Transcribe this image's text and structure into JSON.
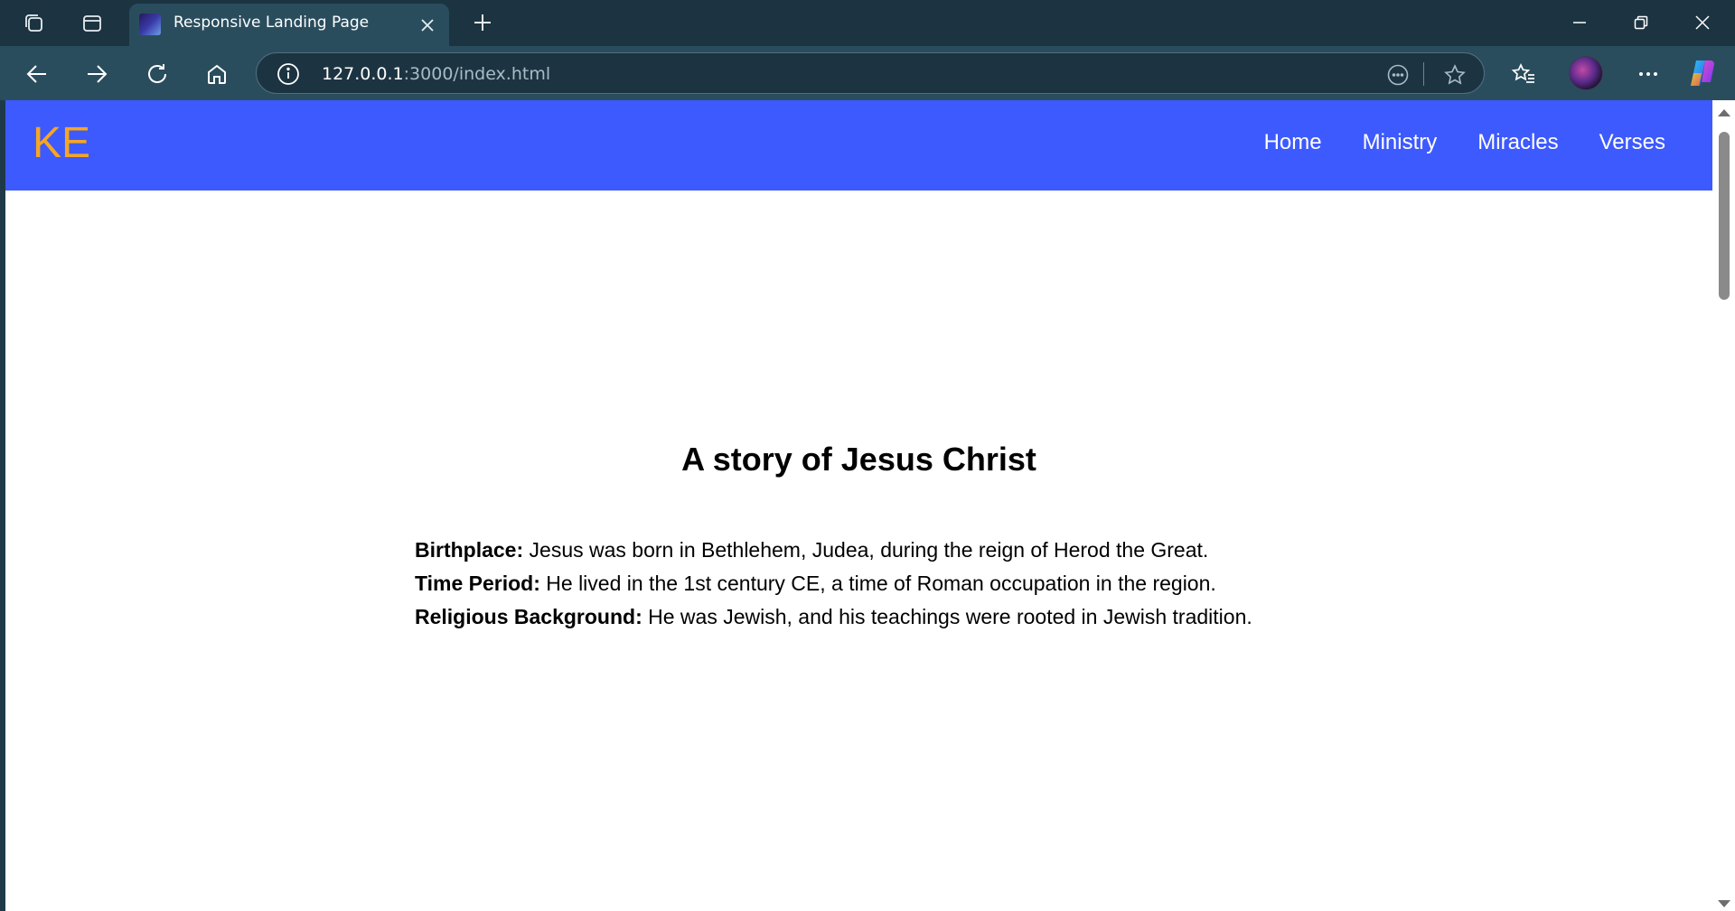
{
  "browser": {
    "tab_title": "Responsive Landing Page",
    "url_host": "127.0.0.1",
    "url_rest": ":3000/index.html"
  },
  "site": {
    "logo": "KE",
    "nav": [
      "Home",
      "Ministry",
      "Miracles",
      "Verses"
    ],
    "heading": "A story of Jesus Christ",
    "facts": [
      {
        "label": "Birthplace:",
        "text": " Jesus was born in Bethlehem, Judea, during the reign of Herod the Great."
      },
      {
        "label": "Time Period:",
        "text": " He lived in the 1st century CE, a time of Roman occupation in the region."
      },
      {
        "label": "Religious Background:",
        "text": " He was Jewish, and his teachings were rooted in Jewish tradition."
      }
    ]
  },
  "colors": {
    "header_bg": "#3d5afe",
    "logo": "#f5a623",
    "chrome_bg": "#1c3441",
    "toolbar_bg": "#2a4d5e"
  }
}
